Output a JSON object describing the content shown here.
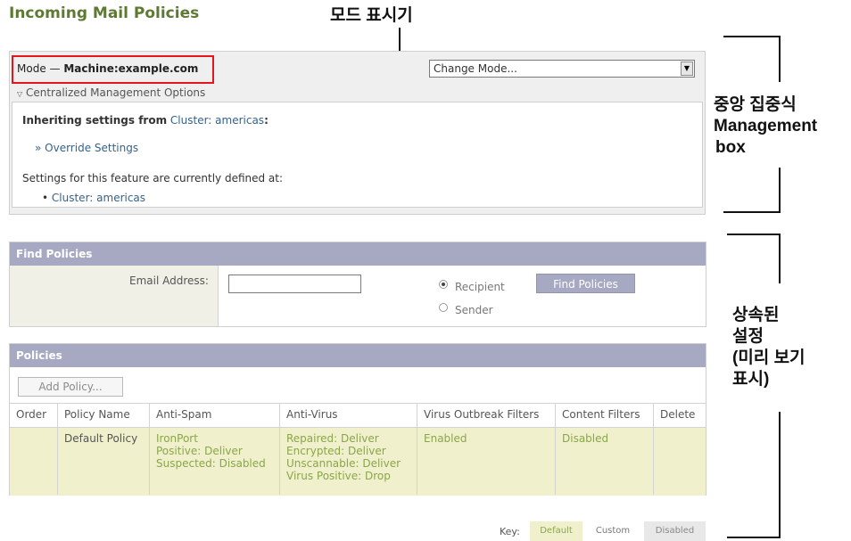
{
  "page_title": "Incoming Mail Policies",
  "callouts": {
    "mode_indicator": "모드 표시기",
    "cm_box": [
      "중앙 집중식",
      "Management",
      "box"
    ],
    "inherited": [
      "상속된",
      "설정",
      "(미리 보기",
      "표시)"
    ]
  },
  "mode": {
    "prefix": "Mode —",
    "value": "Machine:example.com"
  },
  "change_mode": {
    "selected": "Change Mode..."
  },
  "cm_options": {
    "label": "Centralized Management Options"
  },
  "inheriting": {
    "prefix": "Inheriting settings from",
    "source": "Cluster: americas",
    "colon": ":",
    "override_label": "» Override Settings",
    "defined_text": "Settings for this feature are currently defined at:",
    "defined_item": "Cluster: americas"
  },
  "find_policies": {
    "title": "Find Policies",
    "email_label": "Email Address:",
    "email_value": "",
    "recipient_label": "Recipient",
    "sender_label": "Sender",
    "selected": "Recipient",
    "button_label": "Find Policies"
  },
  "policies": {
    "title": "Policies",
    "add_button": "Add Policy...",
    "columns": [
      "Order",
      "Policy Name",
      "Anti-Spam",
      "Anti-Virus",
      "Virus Outbreak Filters",
      "Content Filters",
      "Delete"
    ],
    "rows": [
      {
        "order": "",
        "name": "Default Policy",
        "anti_spam": [
          "IronPort",
          "Positive: Deliver",
          "Suspected: Disabled"
        ],
        "anti_virus": [
          "Repaired: Deliver",
          "Encrypted: Deliver",
          "Unscannable: Deliver",
          "Virus Positive: Drop"
        ],
        "outbreak": "Enabled",
        "content_filters": "Disabled",
        "delete": ""
      }
    ]
  },
  "key": {
    "label": "Key:",
    "default": "Default",
    "custom": "Custom",
    "disabled": "Disabled"
  },
  "colors": {
    "title_green": "#5d7a33",
    "header_lavender": "#a7a9c2",
    "default_row": "#f0f0cc",
    "link_blue": "#35628c",
    "highlight_red": "#e8141b"
  }
}
